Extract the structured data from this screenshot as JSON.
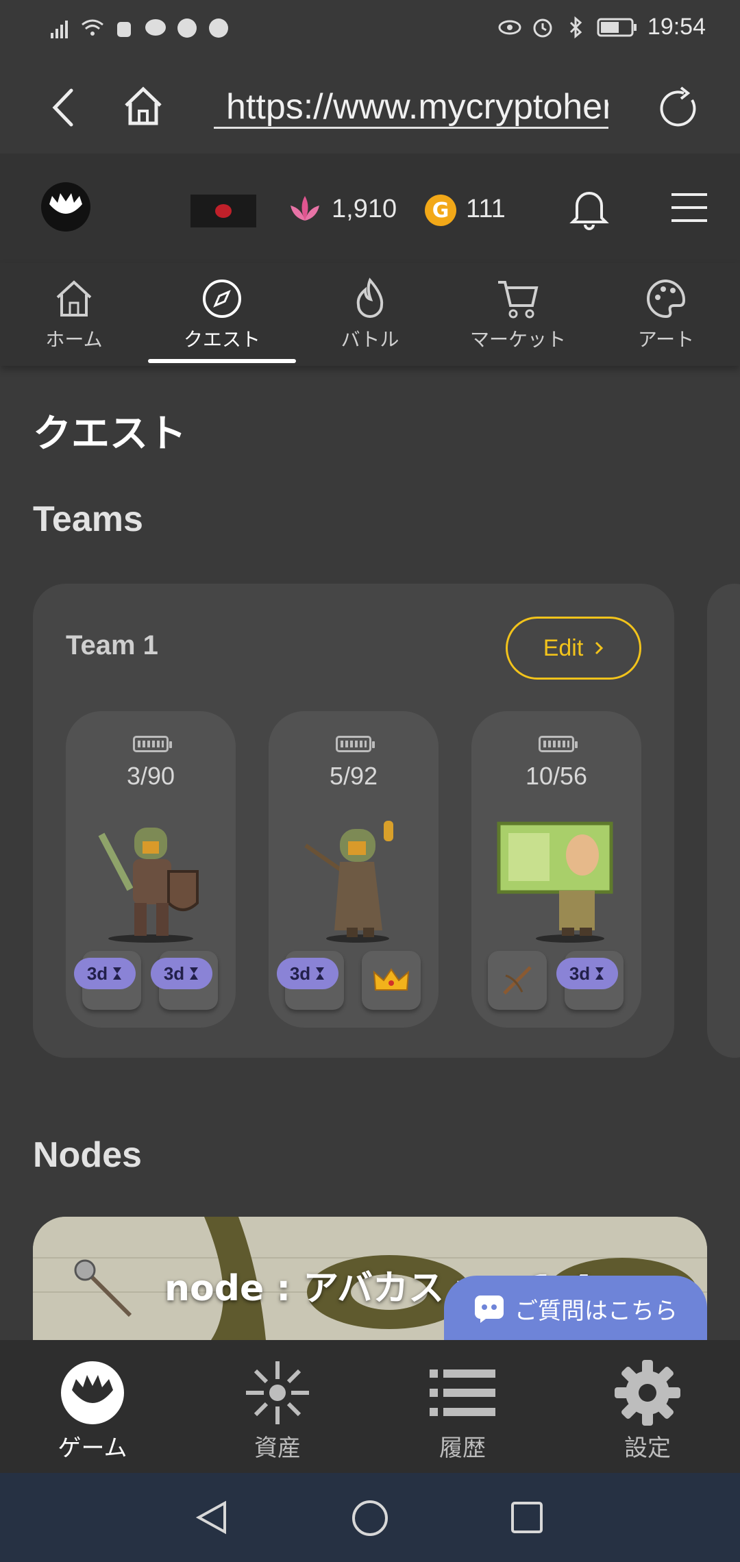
{
  "status_bar": {
    "time": "19:54"
  },
  "browser": {
    "url": "https://www.mycryptoheroes.net/ja/quest"
  },
  "header": {
    "currency_1": "1,910",
    "currency_2": "111",
    "gold_badge": "G"
  },
  "tabs": [
    {
      "label": "ホーム"
    },
    {
      "label": "クエスト"
    },
    {
      "label": "バトル"
    },
    {
      "label": "マーケット"
    },
    {
      "label": "アート"
    }
  ],
  "page": {
    "title": "クエスト"
  },
  "teams_section": {
    "title": "Teams",
    "team": {
      "name": "Team 1",
      "edit_label": "Edit",
      "members": [
        {
          "energy": "3/90",
          "cooldowns": [
            "3d",
            "3d"
          ]
        },
        {
          "energy": "5/92",
          "cooldowns": [
            "3d"
          ]
        },
        {
          "energy": "10/56",
          "cooldowns": [
            "3d"
          ]
        }
      ]
    }
  },
  "nodes_section": {
    "title": "Nodes",
    "node_title": "node : アバカス ver.1.4"
  },
  "discord": {
    "label": "ご質問はこちら"
  },
  "bottom_nav": [
    {
      "label": "ゲーム"
    },
    {
      "label": "資産"
    },
    {
      "label": "履歴"
    },
    {
      "label": "設定"
    }
  ],
  "colors": {
    "accent_yellow": "#f2c31b",
    "cooldown_badge": "#8a83d6",
    "discord_blue": "#6e84d8",
    "background": "#3a3a3a"
  }
}
